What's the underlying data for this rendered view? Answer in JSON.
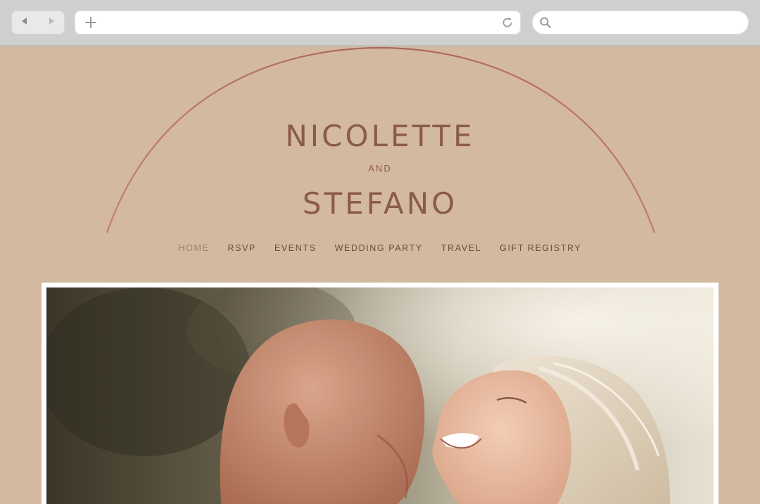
{
  "browser": {
    "back_icon": "back-arrow-icon",
    "forward_icon": "forward-arrow-icon",
    "new_tab_icon": "plus-icon",
    "reload_icon": "reload-icon",
    "search_icon": "search-icon",
    "url_value": "",
    "search_value": ""
  },
  "site": {
    "name_one": "NICOLETTE",
    "conjunction": "AND",
    "name_two": "STEFANO",
    "accent_color": "#8a5c48",
    "background_color": "#d4b9a1",
    "arch_color": "#b7715f"
  },
  "nav": {
    "items": [
      {
        "label": "HOME",
        "active": true
      },
      {
        "label": "RSVP"
      },
      {
        "label": "EVENTS"
      },
      {
        "label": "WEDDING PARTY"
      },
      {
        "label": "TRAVEL"
      },
      {
        "label": "GIFT REGISTRY"
      }
    ]
  },
  "hero": {
    "image": "couple-photo"
  }
}
